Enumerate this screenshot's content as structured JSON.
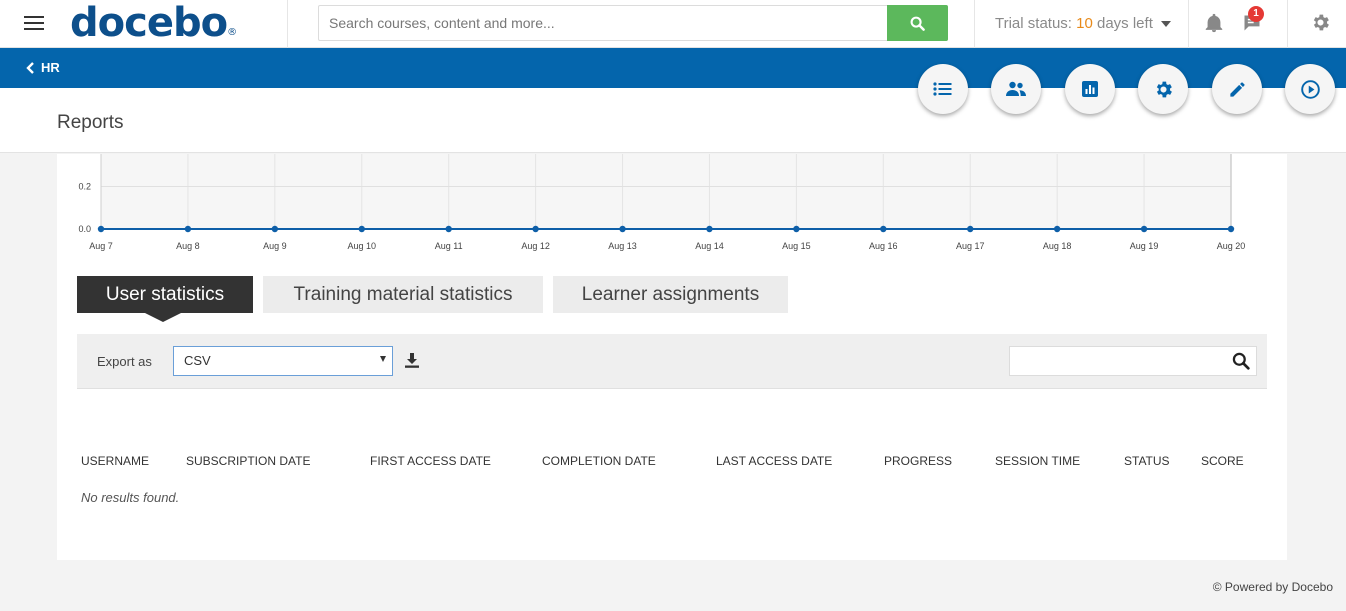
{
  "header": {
    "logo_text": "docebo",
    "logo_mark": "®",
    "search_placeholder": "Search courses, content and more...",
    "trial_prefix": "Trial status: ",
    "trial_days": "10",
    "trial_suffix": " days left",
    "notification_count": "1"
  },
  "nav": {
    "back_label": "HR"
  },
  "page": {
    "title": "Reports"
  },
  "actions": [
    "list-icon",
    "users-icon",
    "report-icon",
    "gear-icon",
    "pencil-icon",
    "play-icon"
  ],
  "chart_data": {
    "type": "line",
    "x": [
      "Aug 7",
      "Aug 8",
      "Aug 9",
      "Aug 10",
      "Aug 11",
      "Aug 12",
      "Aug 13",
      "Aug 14",
      "Aug 15",
      "Aug 16",
      "Aug 17",
      "Aug 18",
      "Aug 19",
      "Aug 20"
    ],
    "series": [
      {
        "values": [
          0,
          0,
          0,
          0,
          0,
          0,
          0,
          0,
          0,
          0,
          0,
          0,
          0,
          0
        ]
      }
    ],
    "yticks": [
      "0.0",
      "0.2"
    ],
    "ylim": [
      0,
      0.4
    ],
    "grid": true,
    "color": "#0e5fa8"
  },
  "tabs": [
    {
      "label": "User statistics",
      "active": true
    },
    {
      "label": "Training material statistics",
      "active": false
    },
    {
      "label": "Learner assignments",
      "active": false
    }
  ],
  "toolbar": {
    "export_label": "Export as",
    "export_value": "CSV",
    "search_value": ""
  },
  "table": {
    "columns": [
      "USERNAME",
      "SUBSCRIPTION DATE",
      "FIRST ACCESS DATE",
      "COMPLETION DATE",
      "LAST ACCESS DATE",
      "PROGRESS",
      "SESSION TIME",
      "STATUS",
      "SCORE"
    ],
    "empty_text": "No results found."
  },
  "footer": {
    "text": "© Powered by Docebo"
  },
  "colors": {
    "brand_blue": "#0465ac",
    "logo_blue": "#0d4f8b",
    "search_green": "#5cb85c",
    "trial_orange": "#e88a1a",
    "badge_red": "#e53935"
  }
}
